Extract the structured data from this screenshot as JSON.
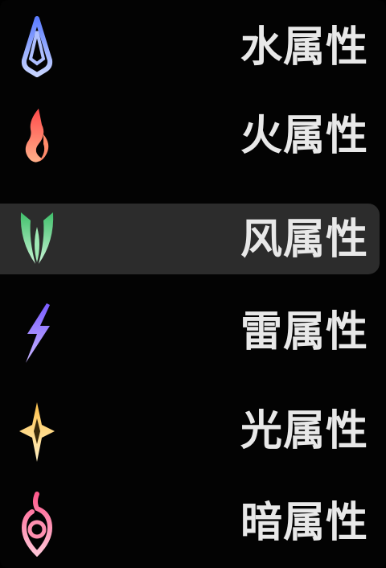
{
  "attribute_menu": {
    "items": [
      {
        "label": "水属性",
        "icon": "water-drop-icon",
        "color": "#8fa8ff",
        "selected": false
      },
      {
        "label": "火属性",
        "icon": "flame-icon",
        "color": "#ff6b6b",
        "selected": false
      },
      {
        "label": "风属性",
        "icon": "wind-leaf-icon",
        "color": "#7fdc9a",
        "selected": true
      },
      {
        "label": "雷属性",
        "icon": "lightning-icon",
        "color": "#a98bff",
        "selected": false
      },
      {
        "label": "光属性",
        "icon": "light-star-icon",
        "color": "#ffd47a",
        "selected": false
      },
      {
        "label": "暗属性",
        "icon": "dark-swirl-icon",
        "color": "#ff7fa8",
        "selected": false
      }
    ]
  }
}
